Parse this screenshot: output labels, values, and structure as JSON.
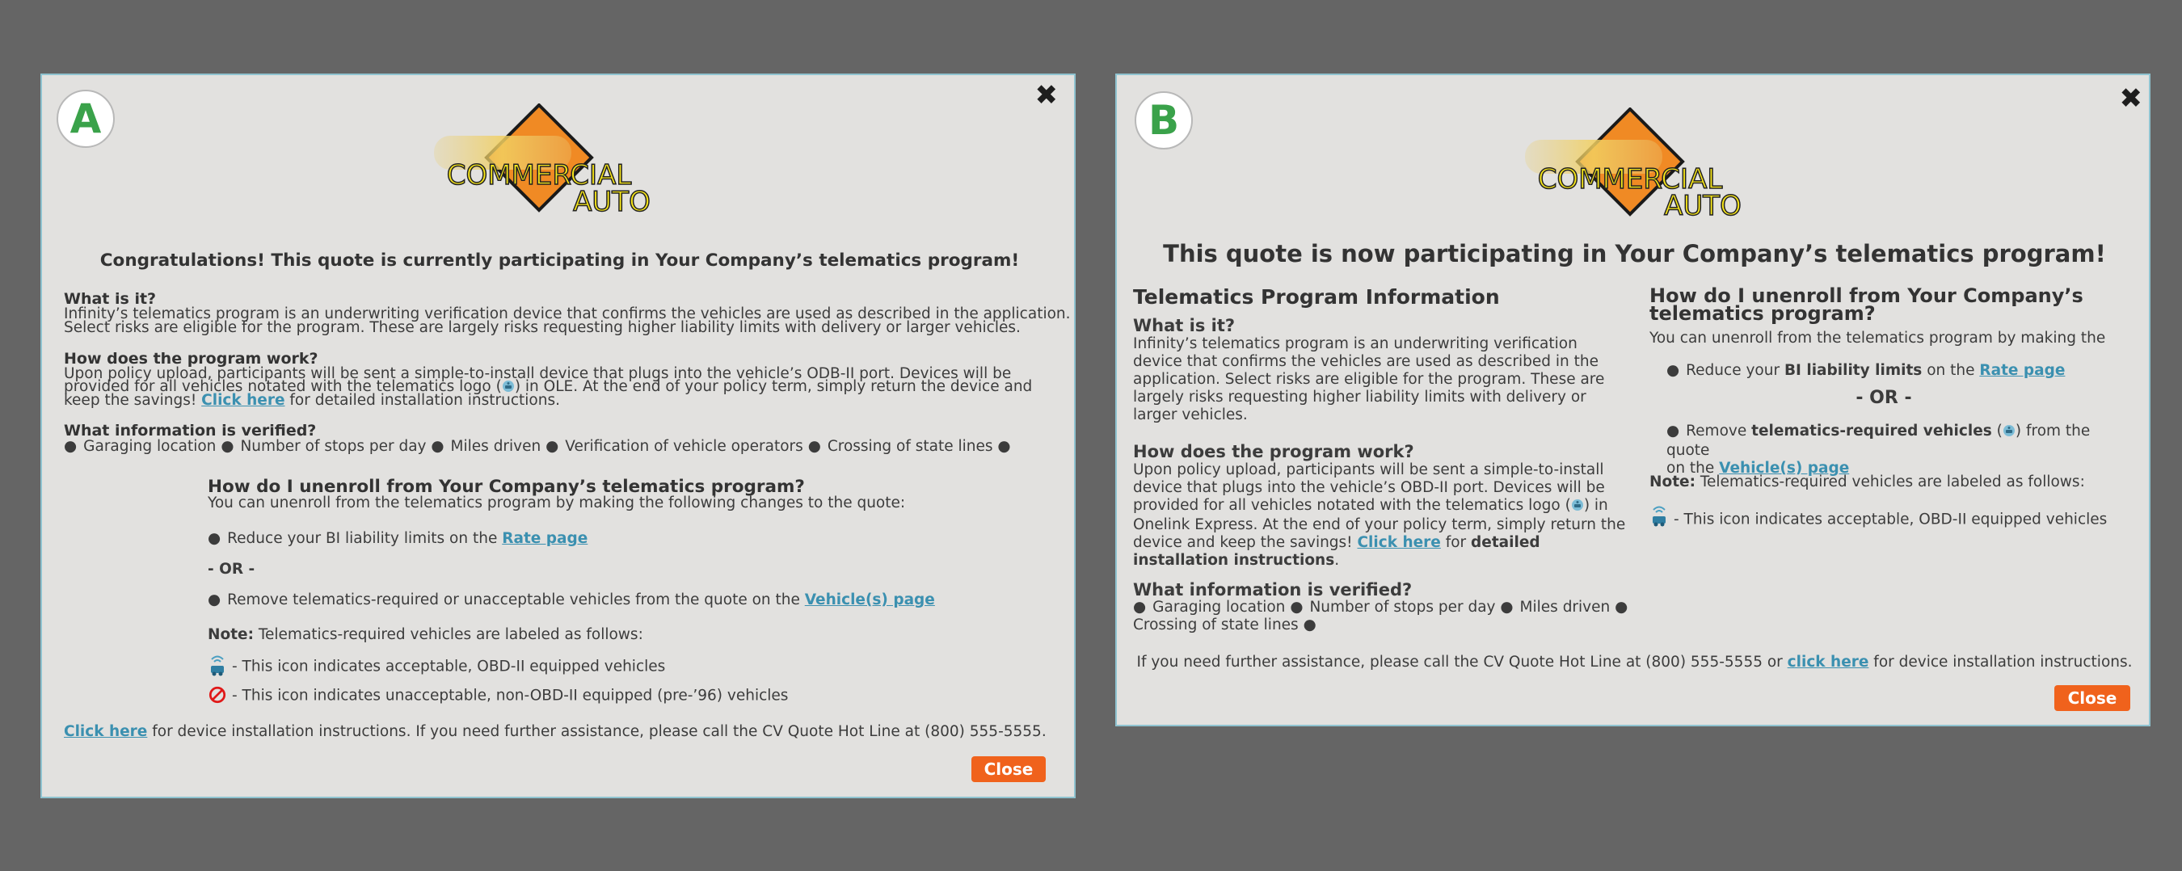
{
  "logo": {
    "line1": "COMMERCIAL",
    "line2": "AUTO"
  },
  "modal_a": {
    "badge": "A",
    "title": "Congratulations! This quote is currently participating in Your Company’s telematics program!",
    "what_heading": "What is it?",
    "what_line1": "Infinity’s telematics program is an underwriting verification device that confirms the vehicles are used as described in the application.",
    "what_line2": "Select risks are eligible for the program. These are largely risks requesting higher liability limits with delivery or larger vehicles.",
    "how_heading": "How does the program work?",
    "how_line1": "Upon policy upload, participants will be sent a simple-to-install device that plugs into the vehicle’s ODB-II port. Devices will be",
    "how_line2a": "provided for all vehicles notated with the telematics logo (",
    "how_line2b": ") in OLE. At the end of your policy term, simply return the device and",
    "how_line3a": "keep the savings! ",
    "how_link": "Click here",
    "how_line3b": " for detailed installation instructions.",
    "verified_heading": "What information is verified?",
    "verified_items": [
      "Garaging location",
      "Number of stops per day",
      "Miles driven",
      "Verification of vehicle operators",
      "Crossing of state lines"
    ],
    "unenroll_heading": "How do I unenroll from Your Company’s telematics program?",
    "unenroll_intro": "You can unenroll from the telematics program by making the following changes to the quote:",
    "opt1_text": "Reduce your BI liability limits on the ",
    "opt1_link": "Rate page",
    "or_text": "- OR -",
    "opt2_text": "Remove telematics-required or unacceptable vehicles from the quote on the ",
    "opt2_link": "Vehicle(s) page",
    "note_label": "Note:",
    "note_text": " Telematics-required vehicles are labeled as follows:",
    "icon1_text": "- This icon indicates acceptable, OBD-II equipped vehicles",
    "icon2_text": "- This icon indicates unacceptable, non-OBD-II equipped (pre-’96) vehicles",
    "footer_link": "Click here",
    "footer_text": " for device installation instructions. If you need further assistance, please call the CV Quote Hot Line at (800) 555-5555.",
    "close_label": "Close"
  },
  "modal_b": {
    "badge": "B",
    "title": "This quote is now participating in Your Company’s telematics program!",
    "info_heading": "Telematics Program Information",
    "what_heading": "What is it?",
    "what_lines": [
      "Infinity’s telematics program is an underwriting verification",
      "device that confirms the vehicles are used as described in the",
      "application. Select risks are eligible for the program. These are",
      "largely risks requesting higher liability limits with delivery or",
      "larger vehicles."
    ],
    "how_heading": "How does the program work?",
    "how_lines": [
      "Upon policy upload, participants will be sent a simple-to-install",
      "device that plugs into the vehicle’s OBD-II port. Devices will be"
    ],
    "how_line3a": "provided for all vehicles notated with the telematics logo (",
    "how_line3b": ") in",
    "how_line4": "Onelink Express. At the end of your policy term, simply return the",
    "how_line5a": "device and keep the savings! ",
    "how_link": "Click here",
    "how_line5b": " for ",
    "how_line5c": "detailed",
    "how_line6a": "installation instructions",
    "how_line6b": ".",
    "verified_heading": "What information is verified?",
    "verified_line1": [
      "Garaging location",
      "Number of stops per day",
      "Miles driven"
    ],
    "verified_line2": "Crossing of state lines",
    "unenroll_heading_1": "How do I unenroll from Your Company’s",
    "unenroll_heading_2": "telematics program?",
    "unenroll_intro": "You can unenroll from the telematics program by making the",
    "opt1_a": "Reduce your ",
    "opt1_b": "BI liability limits",
    "opt1_c": " on the ",
    "opt1_link": "Rate page",
    "or_text": "- OR -",
    "opt2_a": "Remove ",
    "opt2_b": "telematics-required vehicles",
    "opt2_c": " (",
    "opt2_d": ") from the quote",
    "opt2_e": "on the ",
    "opt2_link": "Vehicle(s) page",
    "note_label": "Note:",
    "note_text": " Telematics-required vehicles are labeled as follows:",
    "icon1_text": "- This icon indicates acceptable, OBD-II equipped vehicles",
    "footer_a": "If you need further assistance, please call the CV Quote Hot Line at (800) 555-5555 or ",
    "footer_link": "click here",
    "footer_b": " for device installation instructions.",
    "close_label": "Close"
  },
  "colors": {
    "accent_link": "#3b90b0",
    "close_button": "#f0621c",
    "badge_letter": "#3aa24a"
  }
}
